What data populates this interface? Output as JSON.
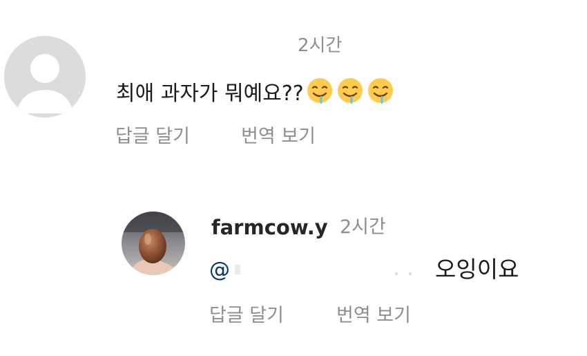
{
  "comment1": {
    "time": "2시간",
    "text": "최애 과자가 뭐예요??",
    "emojis": [
      "drooling-face-icon",
      "drooling-face-icon",
      "drooling-face-icon"
    ],
    "reply_label": "답글 달기",
    "translate_label": "번역 보기"
  },
  "comment2": {
    "username": "farmcow.y",
    "time": "2시간",
    "mention": "@",
    "text": "오잉이요",
    "reply_label": "답글 달기",
    "translate_label": "번역 보기"
  },
  "colors": {
    "muted": "#8e8e8e",
    "text": "#1a1a1a",
    "mention": "#00376b",
    "avatar_placeholder": "#dcdcdc"
  }
}
